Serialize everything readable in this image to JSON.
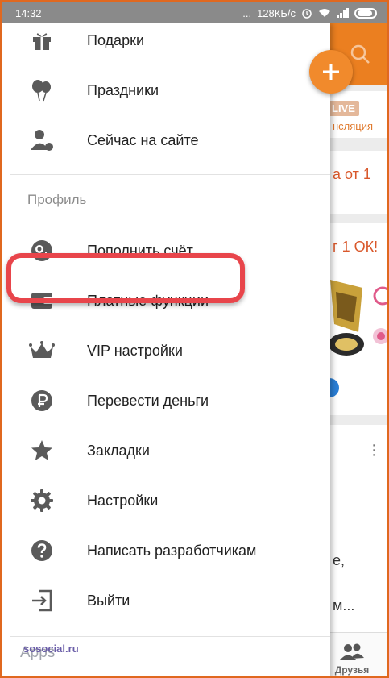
{
  "status_bar": {
    "time": "14:32",
    "dots": "...",
    "network_speed": "128КБ/с"
  },
  "background_app": {
    "live_badge": "LIVE",
    "live_caption": "нсляция",
    "promo_text": "а от 1",
    "ok_text": "г 1 ОК!",
    "text_line_1": "е,",
    "text_line_2": "м...",
    "bottom_nav_friends": "Друзья"
  },
  "drawer": {
    "items_top": [
      {
        "label": "Подарки",
        "icon": "gift-icon"
      },
      {
        "label": "Праздники",
        "icon": "balloons-icon"
      },
      {
        "label": "Сейчас на сайте",
        "icon": "user-online-icon"
      }
    ],
    "section_title": "Профиль",
    "items_profile": [
      {
        "label": "Пополнить счёт",
        "icon": "add-funds-icon"
      },
      {
        "label": "Платные функции",
        "icon": "wallet-icon"
      },
      {
        "label": "VIP настройки",
        "icon": "crown-icon"
      },
      {
        "label": "Перевести деньги",
        "icon": "ruble-icon"
      },
      {
        "label": "Закладки",
        "icon": "star-icon"
      },
      {
        "label": "Настройки",
        "icon": "gear-icon"
      },
      {
        "label": "Написать разработчикам",
        "icon": "help-icon"
      },
      {
        "label": "Выйти",
        "icon": "logout-icon"
      }
    ],
    "bottom_partial_label": "Apps"
  },
  "watermark": "sosocial.ru",
  "colors": {
    "accent_orange": "#eb7f20",
    "highlight_red": "#e8454b",
    "icon_gray": "#5a5a5a"
  }
}
